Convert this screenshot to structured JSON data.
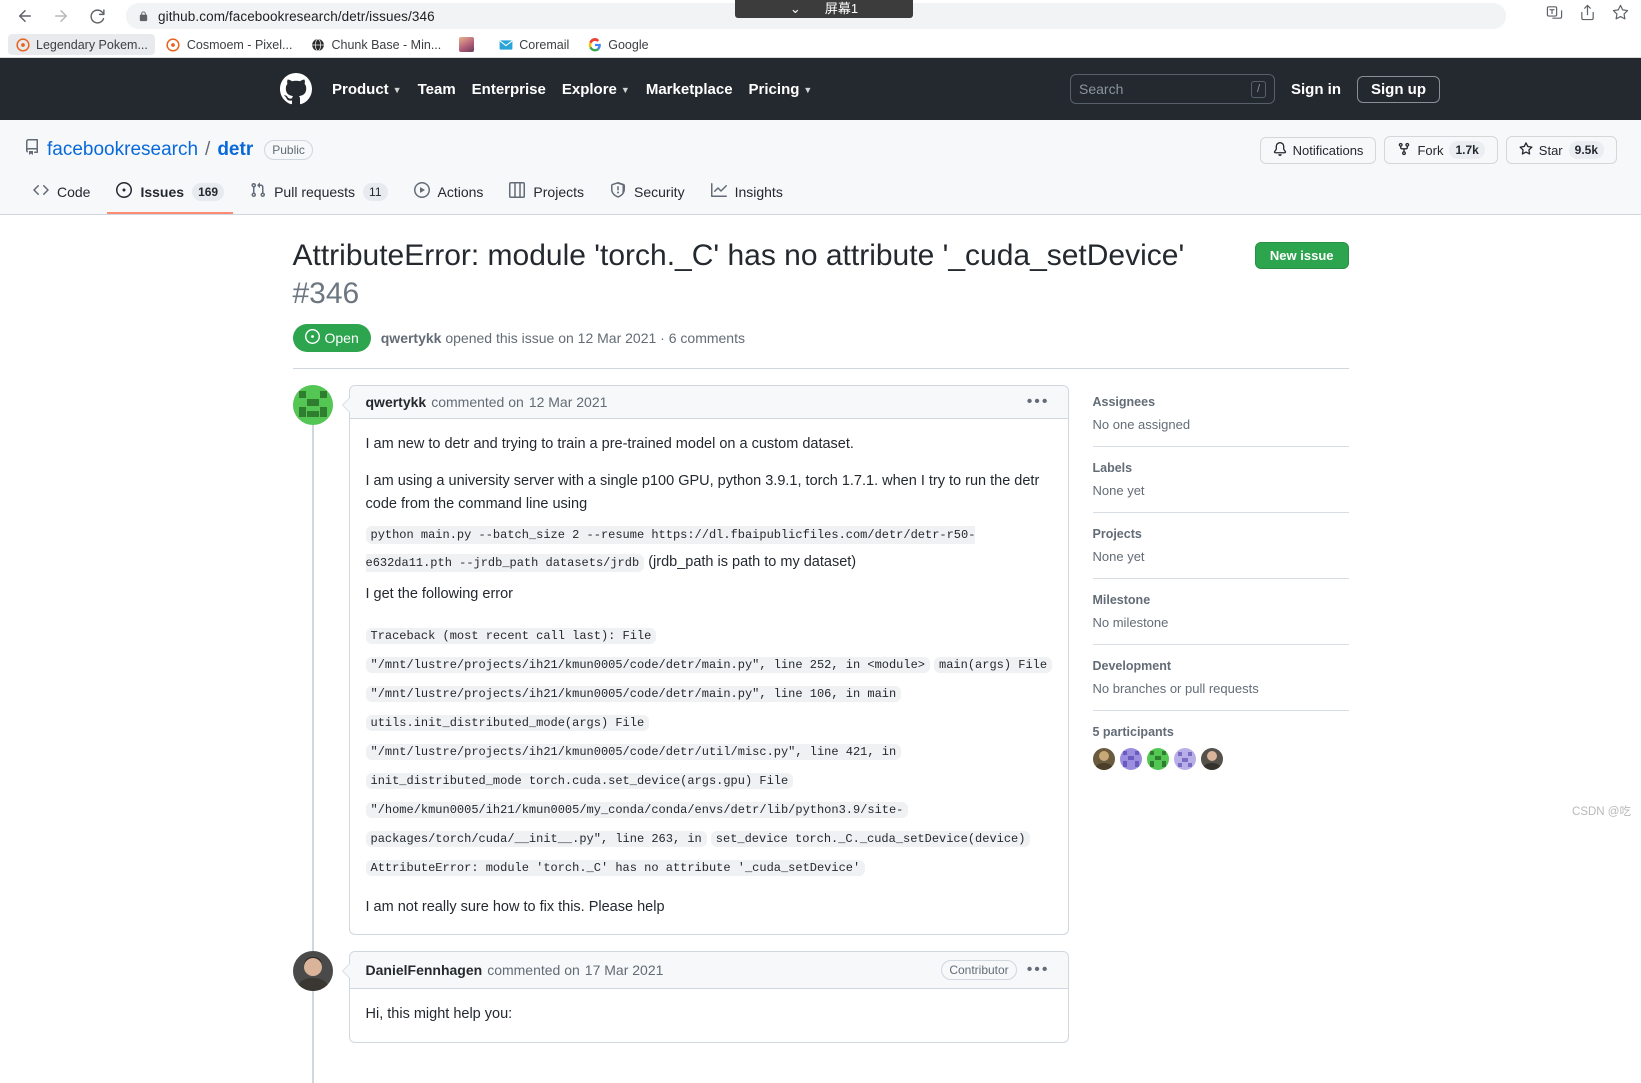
{
  "browser": {
    "back_icon": "back-arrow-icon",
    "forward_icon": "forward-arrow-icon",
    "reload_icon": "reload-icon",
    "url_host": "github.com",
    "url_path": "/facebookresearch/detr/issues/346",
    "url_full": "github.com/facebookresearch/detr/issues/346",
    "popup_text": "屏幕1",
    "bookmarks": [
      {
        "label": "Legendary Pokem...",
        "icon": "pokeball-icon"
      },
      {
        "label": "Cosmoem - Pixel...",
        "icon": "pokeball-icon"
      },
      {
        "label": "Chunk Base - Min...",
        "icon": "globe-icon"
      },
      {
        "label": "",
        "icon": "anime-avatar-icon"
      },
      {
        "label": "Coremail",
        "icon": "mail-icon"
      },
      {
        "label": "Google",
        "icon": "google-g-icon"
      }
    ]
  },
  "gh_header": {
    "logo": "github-mark-icon",
    "nav": [
      {
        "label": "Product",
        "has_caret": true
      },
      {
        "label": "Team",
        "has_caret": false
      },
      {
        "label": "Enterprise",
        "has_caret": false
      },
      {
        "label": "Explore",
        "has_caret": true
      },
      {
        "label": "Marketplace",
        "has_caret": false
      },
      {
        "label": "Pricing",
        "has_caret": true
      }
    ],
    "search_placeholder": "Search",
    "search_shortcut": "/",
    "sign_in": "Sign in",
    "sign_up": "Sign up"
  },
  "repo": {
    "owner": "facebookresearch",
    "separator": "/",
    "name": "detr",
    "visibility": "Public",
    "actions": [
      {
        "label": "Notifications",
        "icon": "bell-icon",
        "count": null
      },
      {
        "label": "Fork",
        "icon": "fork-icon",
        "count": "1.7k"
      },
      {
        "label": "Star",
        "icon": "star-icon",
        "count": "9.5k"
      }
    ],
    "tabs": [
      {
        "label": "Code",
        "icon": "code-icon",
        "count": null,
        "active": false
      },
      {
        "label": "Issues",
        "icon": "issue-opened-icon",
        "count": "169",
        "active": true
      },
      {
        "label": "Pull requests",
        "icon": "pull-request-icon",
        "count": "11",
        "active": false
      },
      {
        "label": "Actions",
        "icon": "play-icon",
        "count": null,
        "active": false
      },
      {
        "label": "Projects",
        "icon": "project-board-icon",
        "count": null,
        "active": false
      },
      {
        "label": "Security",
        "icon": "shield-icon",
        "count": null,
        "active": false
      },
      {
        "label": "Insights",
        "icon": "graph-icon",
        "count": null,
        "active": false
      }
    ]
  },
  "issue": {
    "title": "AttributeError: module 'torch._C' has no attribute '_cuda_setDevice'",
    "number": "#346",
    "new_issue_label": "New issue",
    "state": "Open",
    "state_color": "#2da44e",
    "author": "qwertykk",
    "meta_opened": "opened this issue on 12 Mar 2021",
    "meta_comments": "6 comments",
    "meta_separator": "·"
  },
  "comments": [
    {
      "author": "qwertykk",
      "action": "commented on",
      "date": "12 Mar 2021",
      "badge": null,
      "kebab": "…",
      "paragraphs": [
        "I am new to detr and trying to train a pre-trained model on a custom dataset.",
        "I am using a university server with a single p100 GPU, python 3.9.1, torch 1.7.1. when I try to run the detr code from the command line using"
      ],
      "code_inline_1": "python main.py --batch_size 2 --resume https://dl.fbaipublicfiles.com/detr/detr-r50-e632da11.pth --jrdb_path datasets/jrdb",
      "code_inline_1_suffix": "(jrdb_path is path to my dataset)",
      "line_before_traceback": "I get the following error",
      "traceback_lines": [
        "Traceback (most recent call last): File \"/mnt/lustre/projects/ih21/kmun0005/code/detr/main.py\", line 252, in <module>",
        "main(args) File \"/mnt/lustre/projects/ih21/kmun0005/code/detr/main.py\", line 106, in main",
        "utils.init_distributed_mode(args) File \"/mnt/lustre/projects/ih21/kmun0005/code/detr/util/misc.py\", line 421, in",
        "init_distributed_mode torch.cuda.set_device(args.gpu) File",
        "\"/home/kmun0005/ih21/kmun0005/my_conda/conda/envs/detr/lib/python3.9/site-packages/torch/cuda/__init__.py\", line 263, in",
        "set_device torch._C._cuda_setDevice(device) AttributeError: module 'torch._C' has no attribute '_cuda_setDevice'"
      ],
      "closing": "I am not really sure how to fix this. Please help"
    },
    {
      "author": "DanielFennhagen",
      "action": "commented on",
      "date": "17 Mar 2021",
      "badge": "Contributor",
      "kebab": "…",
      "paragraphs": [
        "Hi, this might help you:"
      ]
    }
  ],
  "sidebar": [
    {
      "title": "Assignees",
      "value": "No one assigned"
    },
    {
      "title": "Labels",
      "value": "None yet"
    },
    {
      "title": "Projects",
      "value": "None yet"
    },
    {
      "title": "Milestone",
      "value": "No milestone"
    },
    {
      "title": "Development",
      "value": "No branches or pull requests"
    }
  ],
  "participants": {
    "label": "5 participants",
    "count": 5
  },
  "watermark": "CSDN @吃"
}
